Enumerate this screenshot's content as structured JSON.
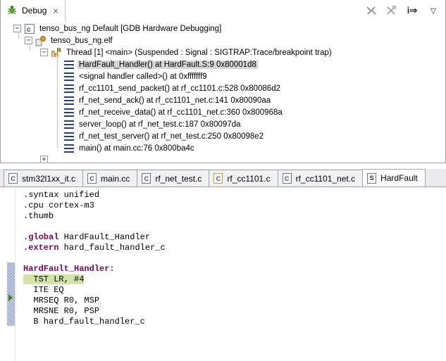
{
  "debug_view": {
    "tab_label": "Debug",
    "close_glyph": "⨯",
    "toolbar_icons": [
      "disconnect-icon",
      "remove-terminated-icon",
      "step-mode-icon",
      "view-menu-icon"
    ],
    "step_glyph": "i⇒",
    "menu_glyph": "▽"
  },
  "tree": {
    "launch": "tenso_bus_ng Default [GDB Hardware Debugging]",
    "process": "tenso_bus_ng.elf",
    "thread": "Thread [1] <main> (Suspended : Signal : SIGTRAP:Trace/breakpoint trap)",
    "frames": [
      "HardFault_Handler() at HardFault.S:9 0x80001d8",
      "<signal handler called>() at 0xfffffff9",
      "rf_cc1101_send_packet() at rf_cc1101.c:528 0x80086d2",
      "rf_net_send_ack() at rf_cc1101_net.c:141 0x80090aa",
      "rf_net_receive_data() at rf_cc1101_net.c:360 0x800968a",
      "server_loop() at rf_net_test.c:187 0x80097da",
      "rf_net_test_server() at rf_net_test.c:250 0x80098e2",
      "main() at main.cc:76 0x800ba4c"
    ],
    "expander_minus": "−",
    "expander_plus": "+"
  },
  "editor": {
    "tabs": [
      {
        "label": "stm32l1xx_it.c",
        "icon": "C"
      },
      {
        "label": "main.cc",
        "icon": "C"
      },
      {
        "label": "rf_net_test.c",
        "icon": "C"
      },
      {
        "label": "rf_cc1101.c",
        "icon": "C"
      },
      {
        "label": "rf_cc1101_net.c",
        "icon": "C"
      },
      {
        "label": "HardFault",
        "icon": "S"
      }
    ],
    "code": {
      "l1": ".syntax unified",
      "l2": ".cpu cortex-m3",
      "l3": ".thumb",
      "l4": "",
      "l5_kw": ".global",
      "l5_rest": " HardFault_Handler",
      "l6_kw": ".extern",
      "l6_rest": " hard_fault_handler_c",
      "l7": "",
      "l8": "HardFault_Handler:",
      "l9": "  TST LR, #4",
      "l10": "  ITE EQ",
      "l11": "  MRSEQ R0, MSP",
      "l12": "  MRSNE R0, PSP",
      "l13": "  B hard_fault_handler_c"
    }
  }
}
